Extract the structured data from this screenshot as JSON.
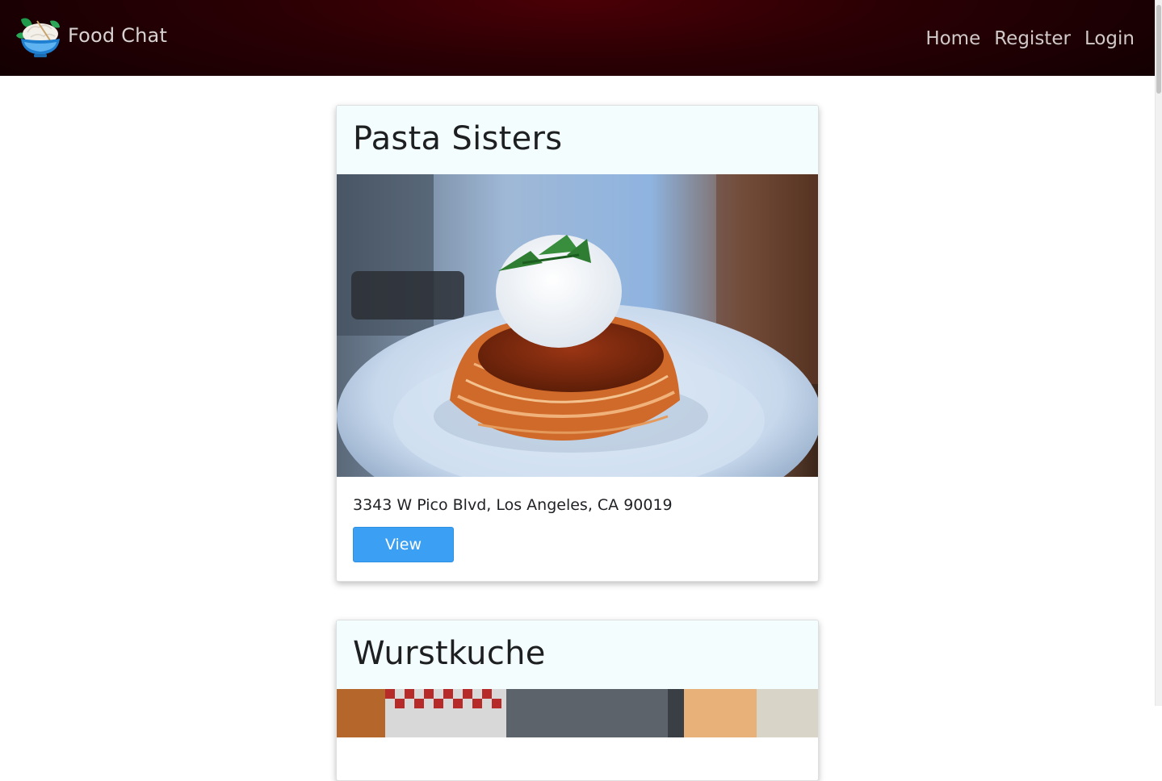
{
  "navbar": {
    "brand_text": "Food Chat",
    "links": [
      {
        "label": "Home"
      },
      {
        "label": "Register"
      },
      {
        "label": "Login"
      }
    ]
  },
  "restaurants": [
    {
      "name": "Pasta Sisters",
      "address": "3343 W Pico Blvd, Los Angeles, CA 90019",
      "button_label": "View"
    },
    {
      "name": "Wurstkuche"
    }
  ],
  "colors": {
    "navbar_dark": "#130002",
    "navbar_accent": "#4a0006",
    "card_header_bg": "#f4fdfd",
    "button_primary": "#3b9ff3"
  },
  "icons": {
    "brand": "food-bowl-logo-icon"
  }
}
